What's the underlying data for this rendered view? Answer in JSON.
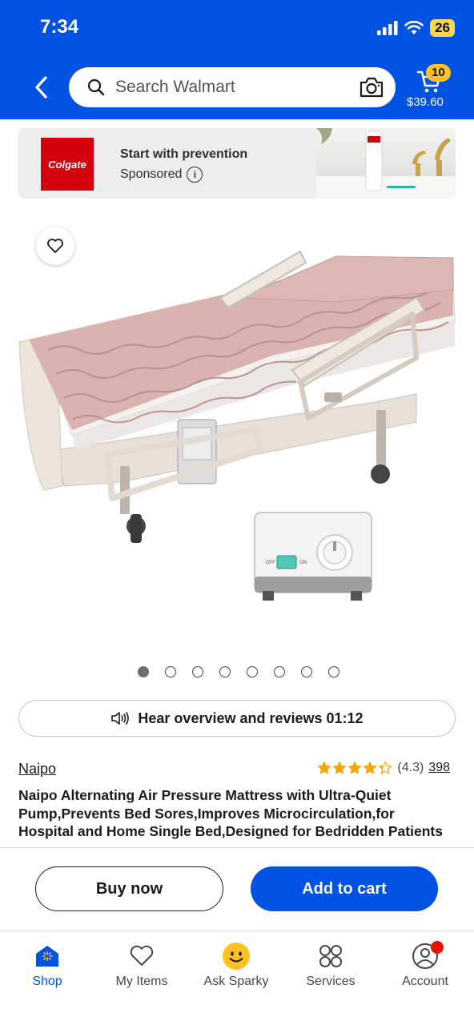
{
  "status_bar": {
    "time": "7:34",
    "battery": "26"
  },
  "header": {
    "search_placeholder": "Search Walmart",
    "cart_count": "10",
    "cart_total": "$39.60"
  },
  "banner": {
    "logo_text": "Colgate",
    "title": "Start with prevention",
    "sponsored_label": "Sponsored"
  },
  "carousel": {
    "total": 8,
    "active_index": 0
  },
  "hear_overview": {
    "label": "Hear overview and reviews 01:12"
  },
  "product": {
    "brand": "Naipo",
    "rating_value": "(4.3)",
    "rating": 4.3,
    "review_count": "398",
    "title": "Naipo Alternating Air Pressure Mattress with Ultra-Quiet Pump,Prevents Bed Sores,Improves Microcirculation,for Hospital and Home Single Bed,Designed for Bedridden Patients"
  },
  "actions": {
    "buy_now": "Buy now",
    "add_to_cart": "Add to cart"
  },
  "bottom_nav": {
    "items": [
      {
        "label": "Shop",
        "icon": "shop-icon"
      },
      {
        "label": "My Items",
        "icon": "heart-icon"
      },
      {
        "label": "Ask Sparky",
        "icon": "sparky-icon"
      },
      {
        "label": "Services",
        "icon": "services-icon"
      },
      {
        "label": "Account",
        "icon": "account-icon"
      }
    ]
  },
  "colors": {
    "brand_blue": "#0053e2",
    "cart_badge": "#ffc220",
    "star": "#f5a700",
    "colgate_red": "#d2010d"
  }
}
